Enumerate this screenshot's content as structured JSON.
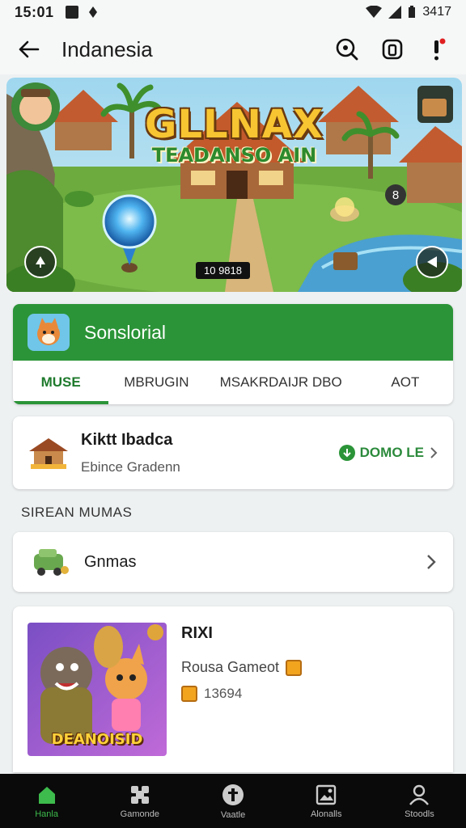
{
  "status_bar": {
    "time": "15:01",
    "battery": "3417"
  },
  "app_bar": {
    "title": "Indanesia"
  },
  "hero": {
    "title": "GLLNAX",
    "subtitle": "TEADANSO AIN",
    "counter": "10 9818",
    "badge": "8"
  },
  "developer": {
    "name": "Sonslorial"
  },
  "tabs": [
    {
      "label": "MUSE",
      "active": true
    },
    {
      "label": "MBRUGIN",
      "active": false
    },
    {
      "label": "MSAKRDAIJR DBO",
      "active": false
    },
    {
      "label": "AOT",
      "active": false
    }
  ],
  "info_card": {
    "title": "Kiktt Ibadca",
    "subtitle": "Ebince Gradenn",
    "action": "DOMO LE"
  },
  "section": {
    "label": "SIREAN MUMAS"
  },
  "games_row": {
    "label": "Gnmas"
  },
  "game": {
    "title": "RIXI",
    "art_label": "DEANOISID",
    "subtitle": "Rousa Gameot",
    "count": "13694"
  },
  "bottom_nav": [
    {
      "label": "Hanla",
      "icon": "home-icon",
      "active": true
    },
    {
      "label": "Gamonde",
      "icon": "gamepad-icon",
      "active": false
    },
    {
      "label": "Vaatle",
      "icon": "info-icon",
      "active": false
    },
    {
      "label": "Alonalls",
      "icon": "image-icon",
      "active": false
    },
    {
      "label": "Stoodls",
      "icon": "person-icon",
      "active": false
    }
  ],
  "colors": {
    "accent": "#2b9438",
    "nav_bg": "#0a0a0a",
    "active_nav": "#3dbb4c"
  }
}
